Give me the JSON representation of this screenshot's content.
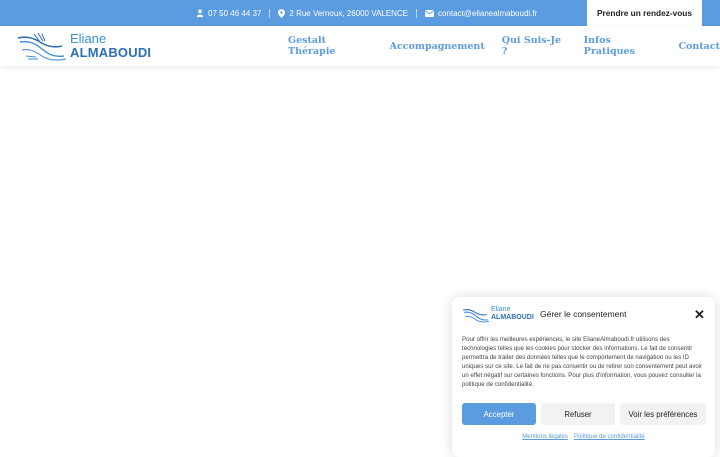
{
  "topbar": {
    "phone": "07 50 46 44 37",
    "address": "2 Rue Vernoux, 26000 VALENCE",
    "email": "contact@elianealmaboudi.fr",
    "cta_label": "Prendre un rendez-vous"
  },
  "header": {
    "logo_line1": "Eliane",
    "logo_line2": "ALMABOUDI",
    "nav": [
      {
        "label": "Gestalt Thérapie"
      },
      {
        "label": "Accompagnement"
      },
      {
        "label": "Qui Suis-Je ?"
      },
      {
        "label": "Infos Pratiques"
      },
      {
        "label": "Contact"
      }
    ]
  },
  "consent": {
    "logo_line1": "Eliane",
    "logo_line2": "ALMABOUDI",
    "title": "Gérer le consentement",
    "body": "Pour offrir les meilleures expériences, le site ElianeAlmaboudi.fr utilisons des technologies telles que les cookies pour stocker des informations. Le fait de consentir permettra de traiter des données telles que le comportement de navigation ou les ID uniques sur ce site. Le fait de ne pas consentir ou de retirer son consentement peut avoir un effet négatif sur certaines fonctions. Pour plus d'information, vous pouvez consulter la politique de confidentialité.",
    "accept_label": "Accepter",
    "refuse_label": "Refuser",
    "prefs_label": "Voir les préférences",
    "link_legal": "Mentions légales",
    "link_privacy": "Politique de confidentialité"
  },
  "colors": {
    "accent": "#5b9be0",
    "logo_dark": "#2f6fb8"
  }
}
